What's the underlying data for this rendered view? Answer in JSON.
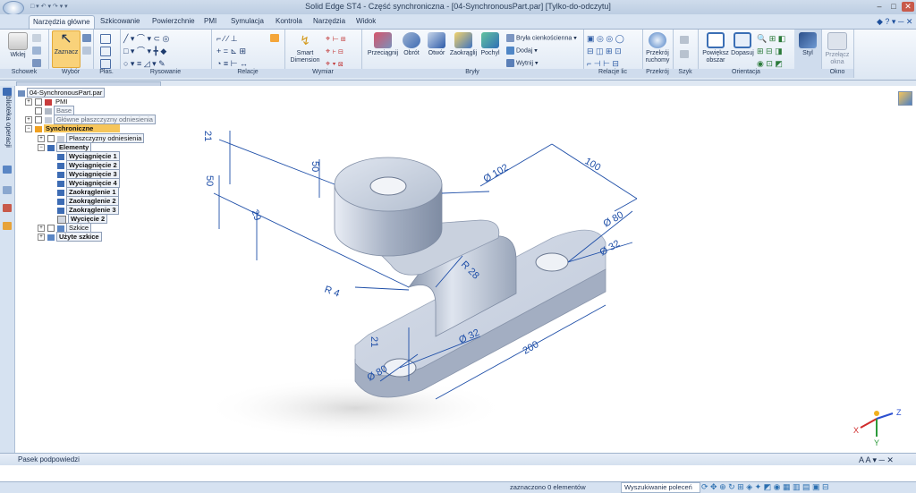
{
  "window": {
    "title": "Solid Edge ST4 - Część synchroniczna - [04-SynchronousPart.par] [Tylko-do-odczytu]"
  },
  "tabs": [
    "Narzędzia główne",
    "Szkicowanie",
    "Powierzchnie",
    "PMI",
    "Symulacja",
    "Kontrola",
    "Narzędzia",
    "Widok"
  ],
  "ribbon": {
    "groups": {
      "clipboard": "Schowek",
      "select": "Wybór",
      "planes": "Płas.",
      "draw": "Rysowanie",
      "relations": "Relacje",
      "dimension": "Wymiar",
      "solids": "Bryły",
      "face_relations": "Relacje lic",
      "section": "Przekrój",
      "pattern": "Szyk",
      "orient": "Orientacja",
      "window": "Okno"
    },
    "buttons": {
      "paste": "Wklej",
      "select": "Zaznacz",
      "smart_dimension_1": "Smart",
      "smart_dimension_2": "Dimension",
      "extrude": "Przeciągnij",
      "revolve": "Obrót",
      "hole": "Otwór",
      "round": "Zaokrąglij",
      "sweep": "Pochyl",
      "thin_wall": "Bryła cienkościenna",
      "add": "Dodaj",
      "cut": "Wytnij",
      "dynamic_section_1": "Przekrój",
      "dynamic_section_2": "ruchomy",
      "zoom_area_1": "Powiększ",
      "zoom_area_2": "obszar",
      "fit": "Dopasuj",
      "style": "Styl",
      "switch_window_1": "Przełącz",
      "switch_window_2": "okna"
    }
  },
  "sidebar": {
    "label": "Biblioteka operacji"
  },
  "tree": {
    "root": "04-SynchronousPart.par",
    "pmi": "PMI",
    "base": "Base",
    "main_planes": "Główne płaszczyzny odniesienia",
    "synchronous": "Synchroniczne",
    "ref_planes": "Płaszczyzny odniesienia",
    "features": "Elementy",
    "items": [
      "Wyciągnięcie 1",
      "Wyciągnięcie 2",
      "Wyciągnięcie 3",
      "Wyciągnięcie 4",
      "Zaokrąglenie 1",
      "Zaokrąglenie 2",
      "Zaokrąglenie 3",
      "Wycięcie 2"
    ],
    "sketches": "Szkice",
    "used_sketches": "Użyte szkice"
  },
  "dimensions": {
    "d21_top": "21",
    "d50_a": "50",
    "d50_b": "50",
    "d29": "29",
    "d102": "Ø 102",
    "d100": "100",
    "d80": "Ø 80",
    "d32_right": "Ø 32",
    "r28": "R 28",
    "r4": "R 4",
    "d21_bottom": "21",
    "d32_bottom": "Ø 32",
    "d80_bottom": "Ø 80",
    "d200": "200"
  },
  "triad": {
    "x": "X",
    "y": "Y",
    "z": "Z"
  },
  "prompt": {
    "label": "Pasek podpowiedzi"
  },
  "status": {
    "selected": "zaznaczono 0 elementów",
    "command_search": "Wyszukiwanie poleceń"
  },
  "colors": {
    "dimension": "#1f4fa8",
    "part": "#aeb8c9",
    "highlight": "#f6c55a"
  }
}
